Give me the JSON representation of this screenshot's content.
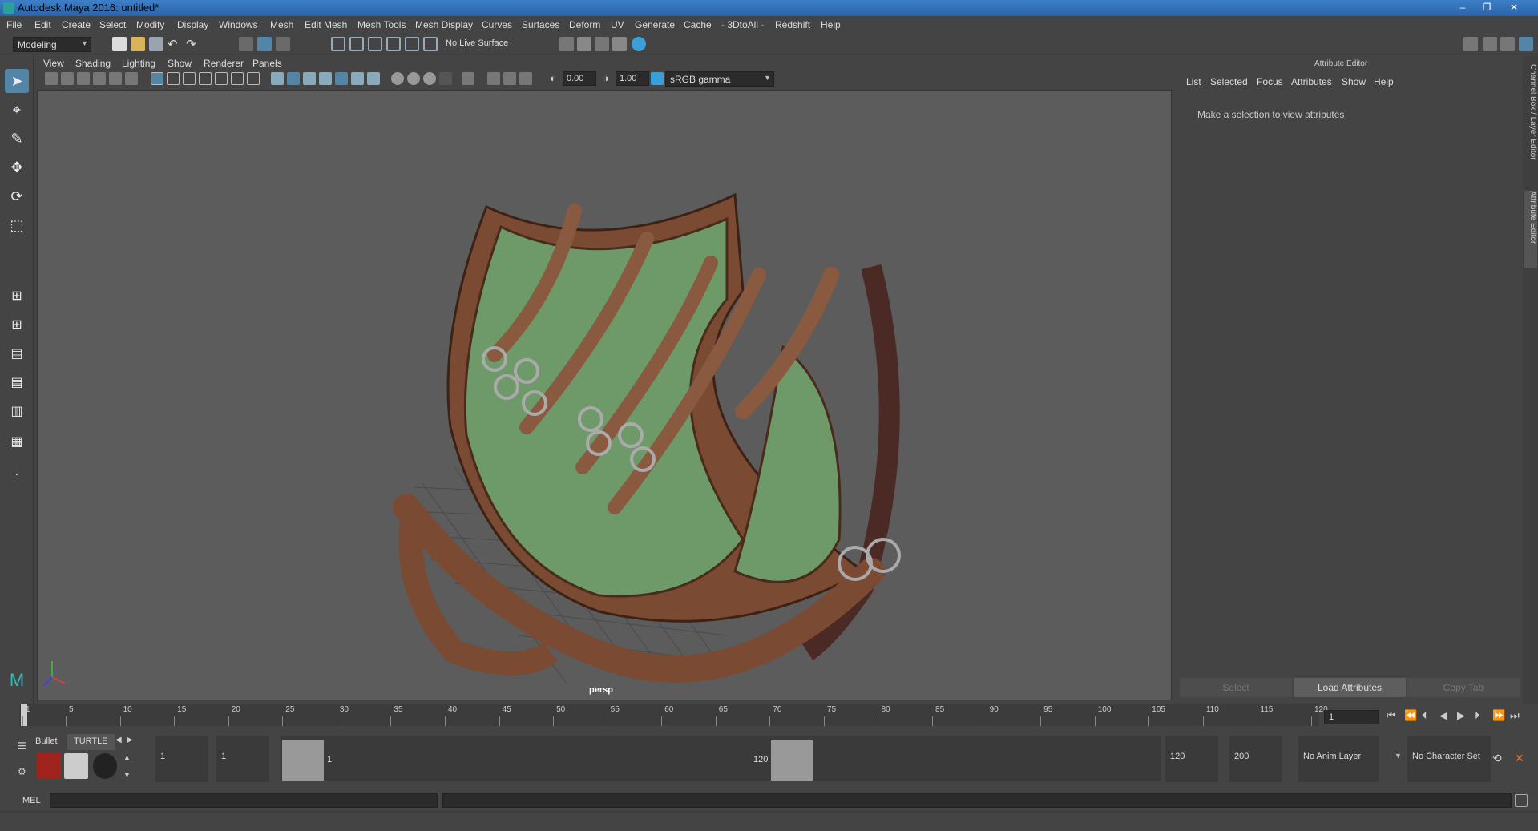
{
  "window": {
    "title": "Autodesk Maya 2016: untitled*",
    "minimize_glyph": "–",
    "restore_glyph": "❐",
    "close_glyph": "✕"
  },
  "menu": [
    "File",
    "Edit",
    "Create",
    "Select",
    "Modify",
    "Display",
    "Windows",
    "Mesh",
    "Edit Mesh",
    "Mesh Tools",
    "Mesh Display",
    "Curves",
    "Surfaces",
    "Deform",
    "UV",
    "Generate",
    "Cache",
    "- 3DtoAll -",
    "Redshift",
    "Help"
  ],
  "statusline": {
    "mode": "Modeling",
    "live_surface": "No Live Surface"
  },
  "viewport_menu": [
    "View",
    "Shading",
    "Lighting",
    "Show",
    "Renderer",
    "Panels"
  ],
  "viewport_toolbar": {
    "exposure": "0.00",
    "gamma": "1.00",
    "color_space": "sRGB gamma"
  },
  "viewport": {
    "camera": "persp",
    "model": "leather-green-bag"
  },
  "attribute_editor": {
    "title": "Attribute Editor",
    "menu": [
      "List",
      "Selected",
      "Focus",
      "Attributes",
      "Show",
      "Help"
    ],
    "hint": "Make a selection to view attributes",
    "buttons": {
      "select": "Select",
      "load": "Load Attributes",
      "copy": "Copy Tab"
    }
  },
  "side_tabs": {
    "channel_box": "Channel Box / Layer Editor",
    "attribute_editor": "Attribute Editor"
  },
  "timeline": {
    "ticks": [
      "1",
      "5",
      "10",
      "15",
      "20",
      "25",
      "30",
      "35",
      "40",
      "45",
      "50",
      "55",
      "60",
      "65",
      "70",
      "75",
      "80",
      "85",
      "90",
      "95",
      "100",
      "105",
      "110",
      "115",
      "120"
    ],
    "current_frame": "1"
  },
  "range": {
    "start": "1",
    "playback_start": "1",
    "inner_start": "1",
    "inner_end": "120",
    "playback_end": "120",
    "end": "200",
    "anim_layer": "No Anim Layer",
    "character_set": "No Character Set"
  },
  "shelf": {
    "tabs": [
      "Bullet",
      "TURTLE"
    ]
  },
  "cmdline": {
    "label": "MEL"
  },
  "colors": {
    "accent": "#5285a6",
    "title_bar": "#2a64a8",
    "background": "#444444",
    "viewport": "#5c5c5c",
    "leather": "#7a4a33",
    "canvas": "#6e9a6a"
  }
}
